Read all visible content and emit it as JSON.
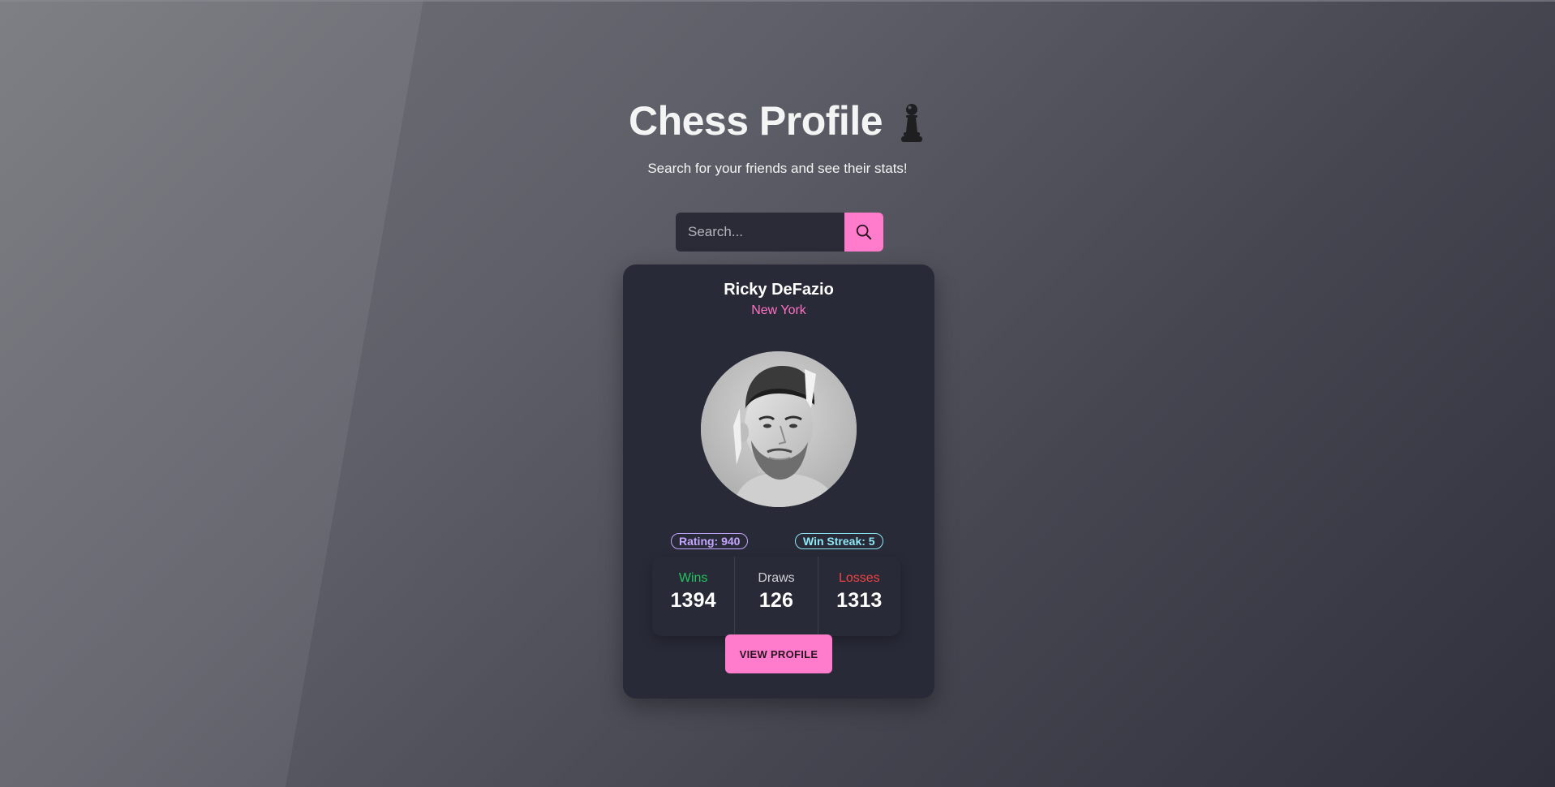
{
  "header": {
    "title": "Chess Profile",
    "title_icon": "chess-pawn-icon",
    "subtitle": "Search for your friends and see their stats!"
  },
  "search": {
    "placeholder": "Search...",
    "value": "",
    "button_icon": "search-icon"
  },
  "profile": {
    "name": "Ricky DeFazio",
    "location": "New York",
    "avatar_icon": "avatar",
    "rating_badge": "Rating: 940",
    "win_streak_badge": "Win Streak: 5",
    "stats": {
      "wins_label": "Wins",
      "wins_value": "1394",
      "draws_label": "Draws",
      "draws_value": "126",
      "losses_label": "Losses",
      "losses_value": "1313"
    },
    "view_button_label": "VIEW PROFILE"
  },
  "colors": {
    "accent_pink": "#ff7ccc",
    "location_pink": "#ff71c4",
    "card_background": "#282a37",
    "wins_green": "#22c55e",
    "losses_red": "#ef4444",
    "rating_purple": "#c4a6ff",
    "streak_cyan": "#8fe7f5"
  }
}
